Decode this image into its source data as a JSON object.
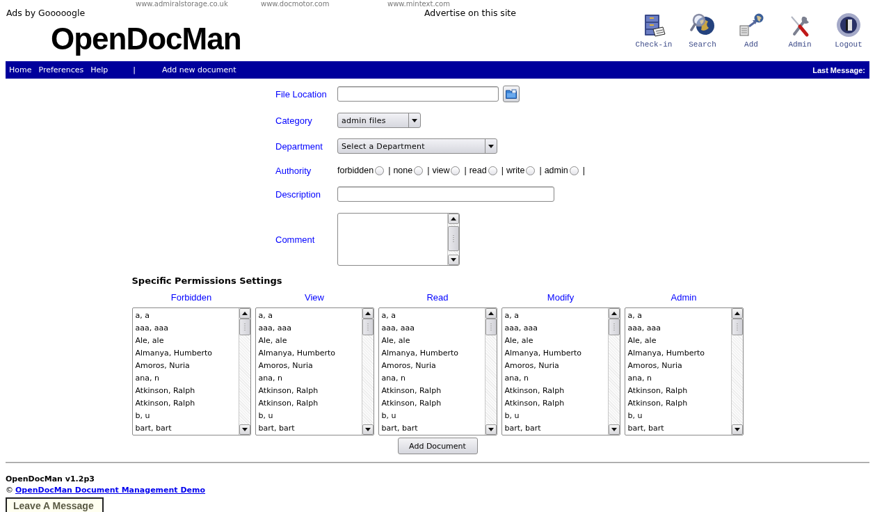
{
  "ads": {
    "links": [
      "www.admiralstorage.co.uk",
      "www.docmotor.com",
      "www.mintext.com"
    ],
    "label": "Ads by Gooooogle",
    "advertise": "Advertise on this site"
  },
  "logo": "OpenDocMan",
  "toolbar": [
    {
      "kind": "checkin",
      "label": "Check-in"
    },
    {
      "kind": "search",
      "label": "Search"
    },
    {
      "kind": "add",
      "label": "Add"
    },
    {
      "kind": "admin",
      "label": "Admin"
    },
    {
      "kind": "logout",
      "label": "Logout"
    }
  ],
  "nav": {
    "links": [
      "Home",
      "Preferences",
      "Help"
    ],
    "separator": "|",
    "action": "Add new document",
    "last_message": "Last Message:"
  },
  "form": {
    "fields": [
      {
        "kind": "file",
        "label": "File Location"
      },
      {
        "kind": "select",
        "label": "Category",
        "value": "admin files"
      },
      {
        "kind": "select",
        "label": "Department",
        "value": "Select a Department"
      },
      {
        "kind": "radios",
        "label": "Authority",
        "options": [
          {
            "label": "forbidden",
            "checked": false,
            "separator": "|"
          },
          {
            "label": "none",
            "checked": false,
            "separator": "|"
          },
          {
            "label": "view",
            "checked": false,
            "separator": "|"
          },
          {
            "label": "read",
            "checked": false,
            "separator": "|"
          },
          {
            "label": "write",
            "checked": false,
            "separator": "|"
          },
          {
            "label": "admin",
            "checked": false,
            "separator": "|"
          }
        ]
      },
      {
        "kind": "text",
        "label": "Description"
      },
      {
        "kind": "textarea",
        "label": "Comment"
      }
    ]
  },
  "permissions": {
    "title": "Specific Permissions Settings",
    "columns": [
      {
        "heading": "Forbidden",
        "items": [
          {
            "name": "a, a",
            "selected": false
          },
          {
            "name": "aaa, aaa",
            "selected": false
          },
          {
            "name": "Ale, ale",
            "selected": false
          },
          {
            "name": "Almanya, Humberto",
            "selected": false
          },
          {
            "name": "Amoros, Nuria",
            "selected": false
          },
          {
            "name": "ana, n",
            "selected": false
          },
          {
            "name": "Atkinson, Ralph",
            "selected": false
          },
          {
            "name": "Atkinson, Ralph",
            "selected": false
          },
          {
            "name": "b, u",
            "selected": false
          },
          {
            "name": "bart, bart",
            "selected": false
          }
        ]
      },
      {
        "heading": "View",
        "items": [
          {
            "name": "a, a",
            "selected": false
          },
          {
            "name": "aaa, aaa",
            "selected": false
          },
          {
            "name": "Ale, ale",
            "selected": false
          },
          {
            "name": "Almanya, Humberto",
            "selected": false
          },
          {
            "name": "Amoros, Nuria",
            "selected": false
          },
          {
            "name": "ana, n",
            "selected": false
          },
          {
            "name": "Atkinson, Ralph",
            "selected": false
          },
          {
            "name": "Atkinson, Ralph",
            "selected": false
          },
          {
            "name": "b, u",
            "selected": false
          },
          {
            "name": "bart, bart",
            "selected": false
          }
        ]
      },
      {
        "heading": "Read",
        "items": [
          {
            "name": "a, a",
            "selected": false
          },
          {
            "name": "aaa, aaa",
            "selected": false
          },
          {
            "name": "Ale, ale",
            "selected": false
          },
          {
            "name": "Almanya, Humberto",
            "selected": false
          },
          {
            "name": "Amoros, Nuria",
            "selected": false
          },
          {
            "name": "ana, n",
            "selected": false
          },
          {
            "name": "Atkinson, Ralph",
            "selected": false
          },
          {
            "name": "Atkinson, Ralph",
            "selected": false
          },
          {
            "name": "b, u",
            "selected": false
          },
          {
            "name": "bart, bart",
            "selected": false
          }
        ]
      },
      {
        "heading": "Modify",
        "items": [
          {
            "name": "a, a",
            "selected": false
          },
          {
            "name": "aaa, aaa",
            "selected": false
          },
          {
            "name": "Ale, ale",
            "selected": false
          },
          {
            "name": "Almanya, Humberto",
            "selected": false
          },
          {
            "name": "Amoros, Nuria",
            "selected": false
          },
          {
            "name": "ana, n",
            "selected": false
          },
          {
            "name": "Atkinson, Ralph",
            "selected": false
          },
          {
            "name": "Atkinson, Ralph",
            "selected": false
          },
          {
            "name": "b, u",
            "selected": false
          },
          {
            "name": "bart, bart",
            "selected": false
          }
        ]
      },
      {
        "heading": "Admin",
        "items": [
          {
            "name": "a, a",
            "selected": false
          },
          {
            "name": "aaa, aaa",
            "selected": false
          },
          {
            "name": "Ale, ale",
            "selected": false
          },
          {
            "name": "Almanya, Humberto",
            "selected": false
          },
          {
            "name": "Amoros, Nuria",
            "selected": false
          },
          {
            "name": "ana, n",
            "selected": false
          },
          {
            "name": "Atkinson, Ralph",
            "selected": false
          },
          {
            "name": "Atkinson, Ralph",
            "selected": false
          },
          {
            "name": "b, u",
            "selected": false
          },
          {
            "name": "bart, bart",
            "selected": false
          }
        ]
      }
    ]
  },
  "submit": "Add Document",
  "footer": {
    "version": "OpenDocMan v1.2p3",
    "copyright": "©",
    "link": "OpenDocMan Document Management Demo",
    "message_button": "Leave A Message"
  }
}
